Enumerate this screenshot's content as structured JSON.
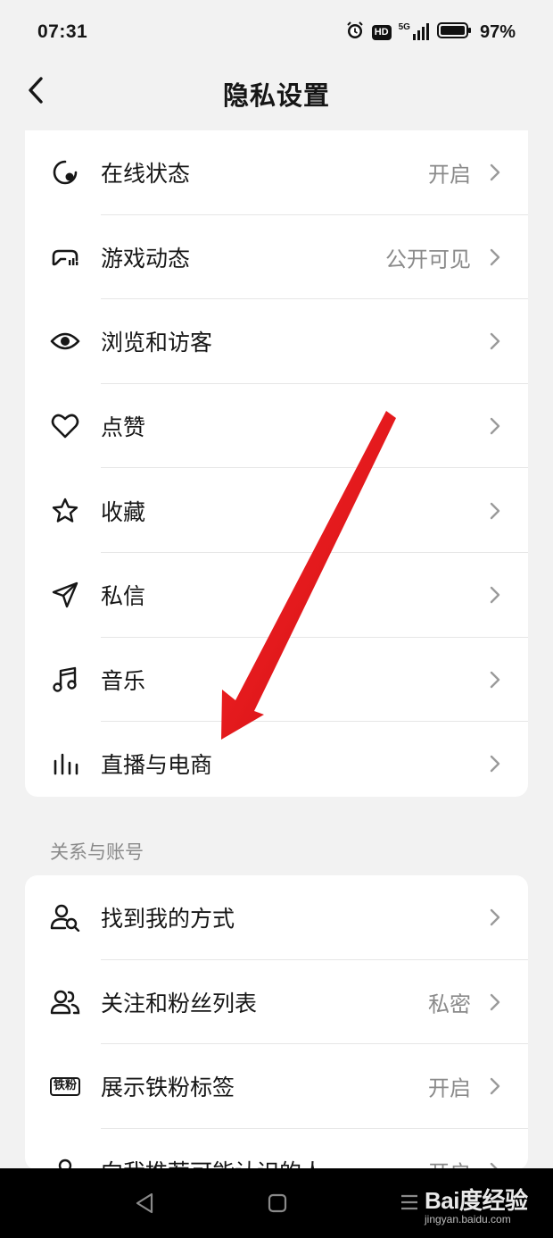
{
  "status_bar": {
    "time": "07:31",
    "hd": "HD",
    "network": "5G",
    "battery": "97%"
  },
  "header": {
    "title": "隐私设置"
  },
  "privacy_items": [
    {
      "label": "在线状态",
      "value": "开启",
      "icon": "online-status-icon"
    },
    {
      "label": "游戏动态",
      "value": "公开可见",
      "icon": "gamepad-icon"
    },
    {
      "label": "浏览和访客",
      "value": "",
      "icon": "eye-icon"
    },
    {
      "label": "点赞",
      "value": "",
      "icon": "heart-icon"
    },
    {
      "label": "收藏",
      "value": "",
      "icon": "star-icon"
    },
    {
      "label": "私信",
      "value": "",
      "icon": "send-icon"
    },
    {
      "label": "音乐",
      "value": "",
      "icon": "music-icon"
    },
    {
      "label": "直播与电商",
      "value": "",
      "icon": "live-bars-icon"
    }
  ],
  "relations_section": {
    "title": "关系与账号",
    "items": [
      {
        "label": "找到我的方式",
        "value": "",
        "icon": "user-search-icon"
      },
      {
        "label": "关注和粉丝列表",
        "value": "私密",
        "icon": "users-icon"
      },
      {
        "label": "展示铁粉标签",
        "value": "开启",
        "icon": "fan-badge-icon",
        "badge_text": "铁粉"
      },
      {
        "label": "向我推荐可能认识的人",
        "value": "开启",
        "icon": "user-icon"
      }
    ]
  },
  "annotation": {
    "arrow_color": "#e8141b"
  },
  "watermark": {
    "logo": "Bai度经验",
    "url": "jingyan.baidu.com"
  }
}
